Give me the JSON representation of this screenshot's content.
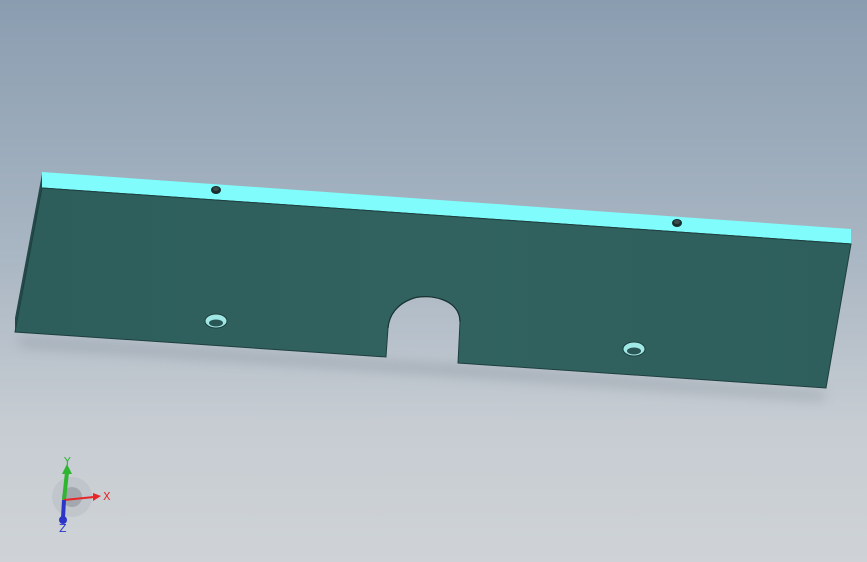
{
  "viewport": {
    "background_top": "#8a9db0",
    "background_bottom": "#cfd3d7"
  },
  "part": {
    "face_color": "#2f615f",
    "top_edge_color": "#7ffcfb",
    "side_color": "#254a49",
    "hole_color": "#9fe8e6"
  },
  "triad": {
    "x_label": "X",
    "y_label": "Y",
    "z_label": "Z",
    "x_color": "#e8262a",
    "y_color": "#2fb52f",
    "z_color": "#2c35c8"
  }
}
